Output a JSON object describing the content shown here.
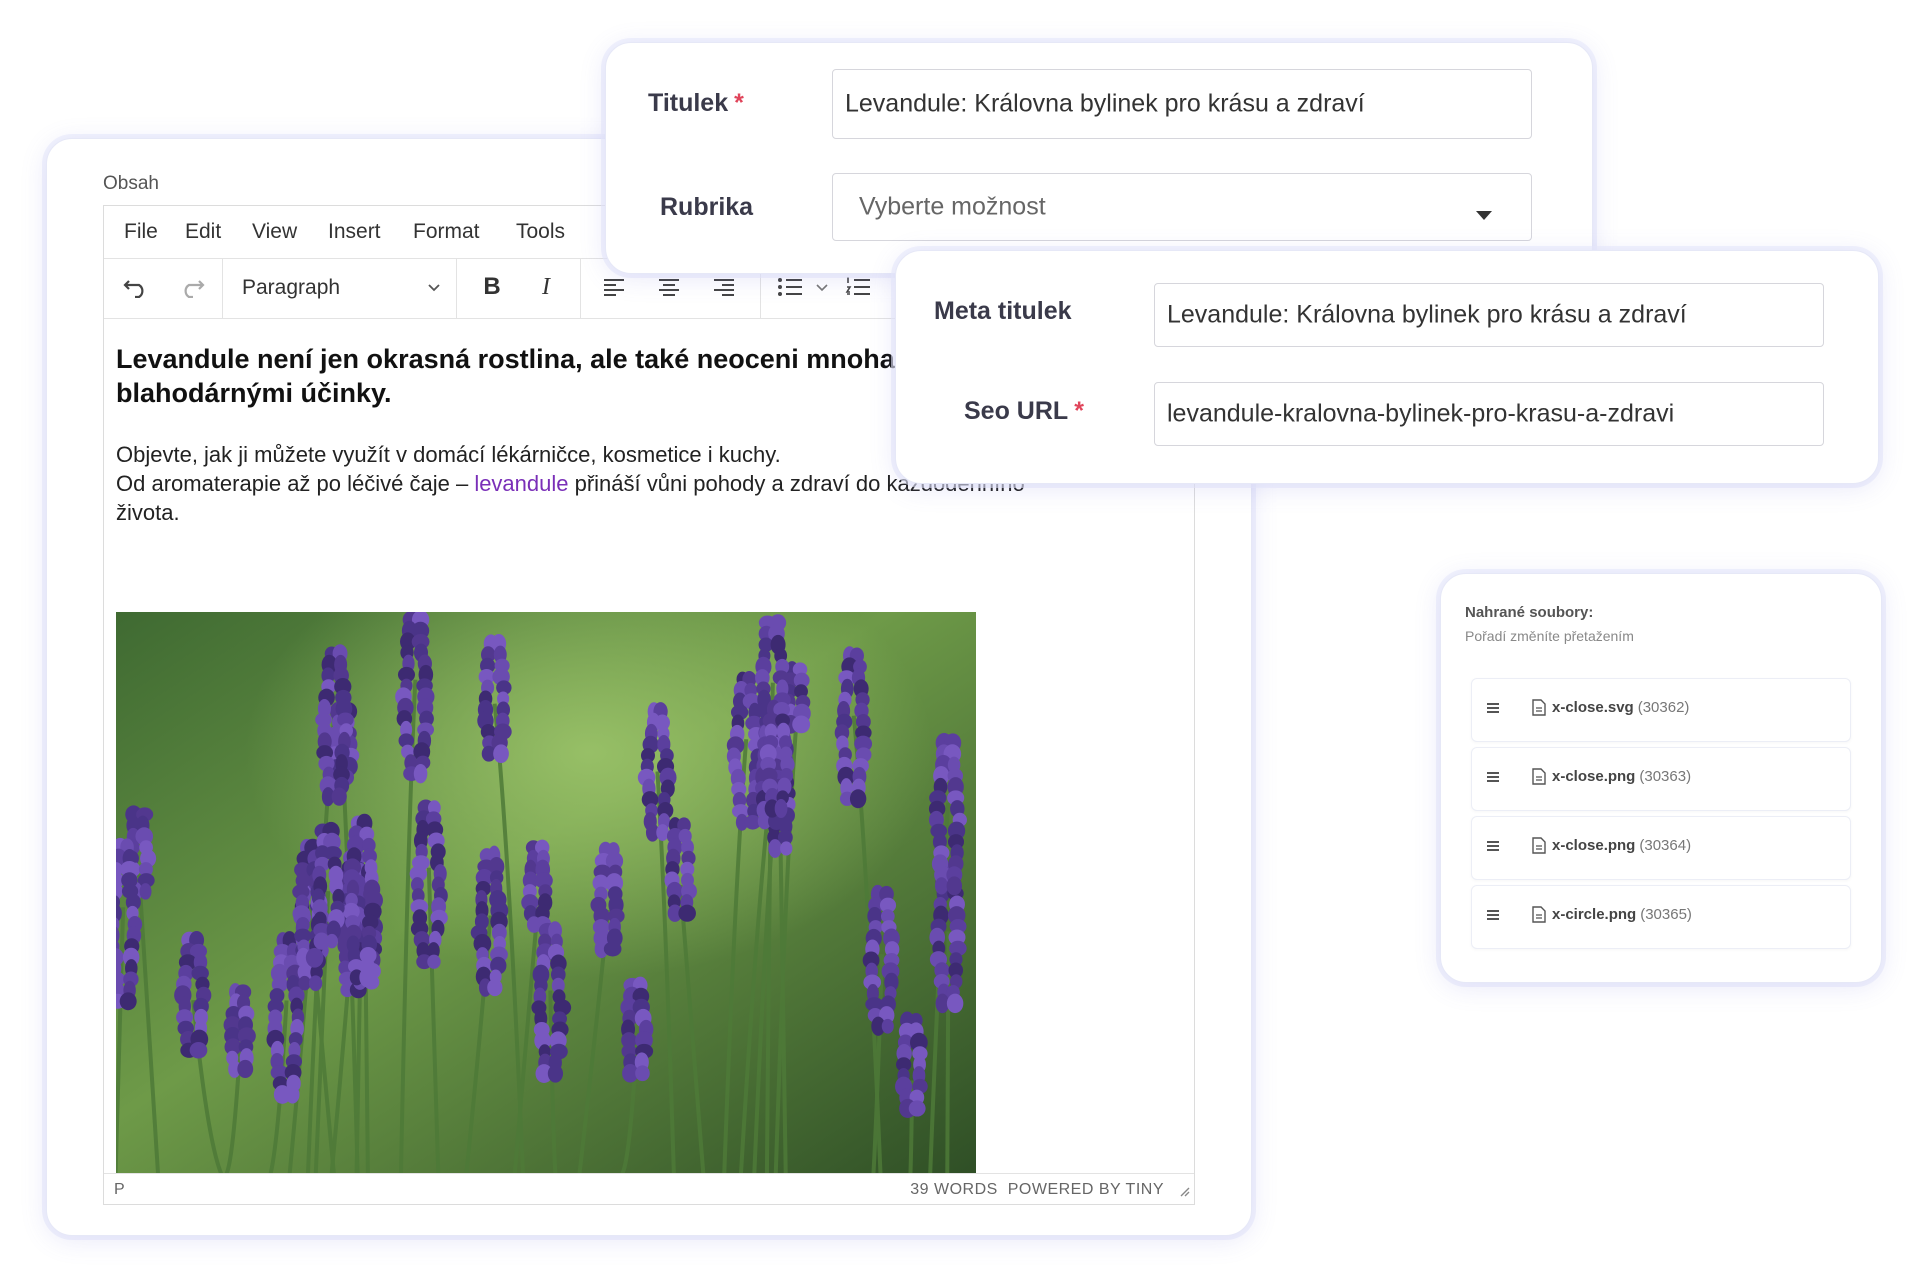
{
  "editor": {
    "content_label": "Obsah",
    "menu": [
      "File",
      "Edit",
      "View",
      "Insert",
      "Format",
      "Tools"
    ],
    "format_select": "Paragraph",
    "heading": "Levandule není jen okrasná rostlina, ale také neoceni mnoha blahodárnými účinky.",
    "paragraph_line1": "Objevte, jak ji můžete využít v domácí lékárničce, kosmetice i kuchy.",
    "paragraph_line2_before": "Od aromaterapie až po léčivé čaje – ",
    "paragraph_link": "levandule",
    "paragraph_line2_after": " přináší vůni pohody a zdraví do každodenního života.",
    "status_path": "P",
    "status_words": "39 WORDS",
    "status_powered": "POWERED BY TINY"
  },
  "form": {
    "title_label": "Titulek",
    "title_value": "Levandule: Královna bylinek pro krásu a zdraví",
    "category_label": "Rubrika",
    "category_placeholder": "Vyberte možnost",
    "meta_title_label": "Meta titulek",
    "meta_title_value": "Levandule: Královna bylinek pro krásu a zdraví",
    "seo_url_label": "Seo URL",
    "seo_url_value": "levandule-kralovna-bylinek-pro-krasu-a-zdravi",
    "required_mark": "*"
  },
  "files": {
    "title": "Nahrané soubory:",
    "subtitle": "Pořadí změníte přetažením",
    "items": [
      {
        "name": "x-close.svg",
        "id": "(30362)"
      },
      {
        "name": "x-close.png",
        "id": "(30363)"
      },
      {
        "name": "x-close.png",
        "id": "(30364)"
      },
      {
        "name": "x-circle.png",
        "id": "(30365)"
      }
    ]
  },
  "colors": {
    "accent": "#7a2fb8",
    "required": "#e0455b",
    "card_glow": "#e6e8f7"
  },
  "icons": [
    "undo-icon",
    "redo-icon",
    "bold-icon",
    "italic-icon",
    "align-left-icon",
    "align-center-icon",
    "align-right-icon",
    "bullet-list-icon",
    "numbered-list-icon",
    "dropdown-arrow-icon",
    "drag-handle-icon",
    "file-icon",
    "resize-handle-icon"
  ]
}
